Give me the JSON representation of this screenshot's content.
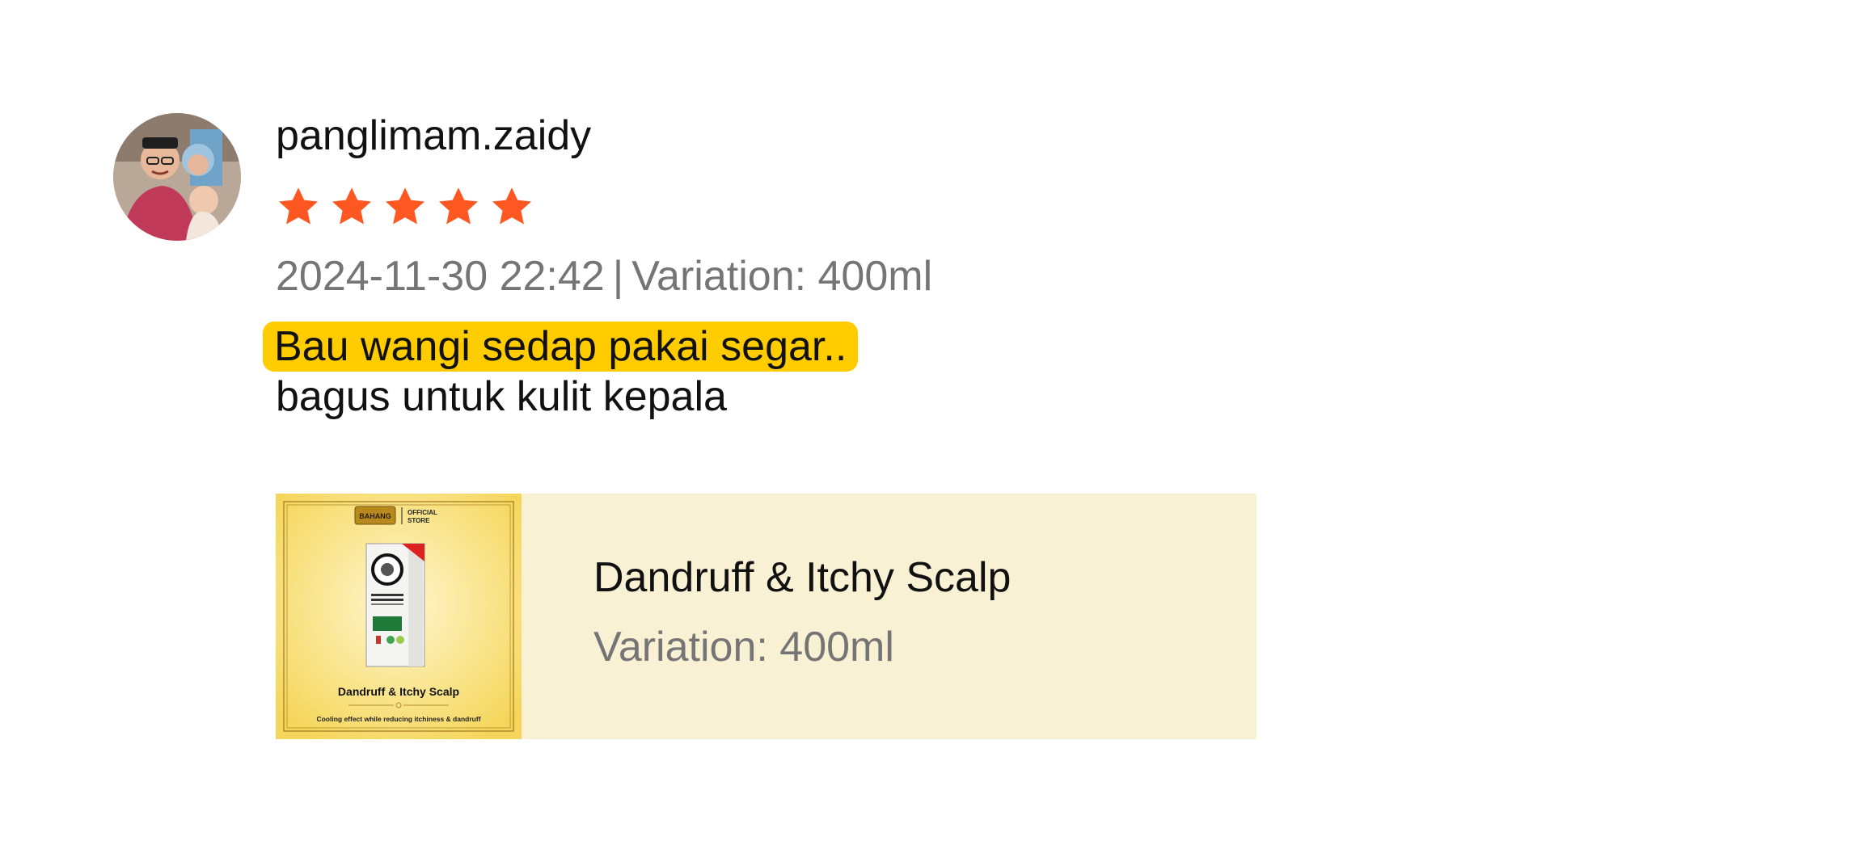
{
  "review": {
    "username": "panglimam.zaidy",
    "rating": 5,
    "star_color": "#ff5722",
    "date": "2024-11-30 22:42",
    "separator": "|",
    "variation_label": "Variation: 400ml",
    "comment_highlight": "Bau wangi sedap pakai segar..",
    "comment_rest": "bagus untuk kulit kepala",
    "highlight_color": "#ffcc00"
  },
  "product": {
    "name": "Dandruff & Itchy Scalp",
    "variation": "Variation: 400ml",
    "background": "#f9f1d4",
    "thumbnail": {
      "brand": "BAHANG",
      "store_badge": [
        "OFFICIAL",
        "STORE"
      ],
      "title": "Dandruff & Itchy Scalp",
      "tagline": "Cooling effect while reducing itchiness & dandruff"
    }
  }
}
